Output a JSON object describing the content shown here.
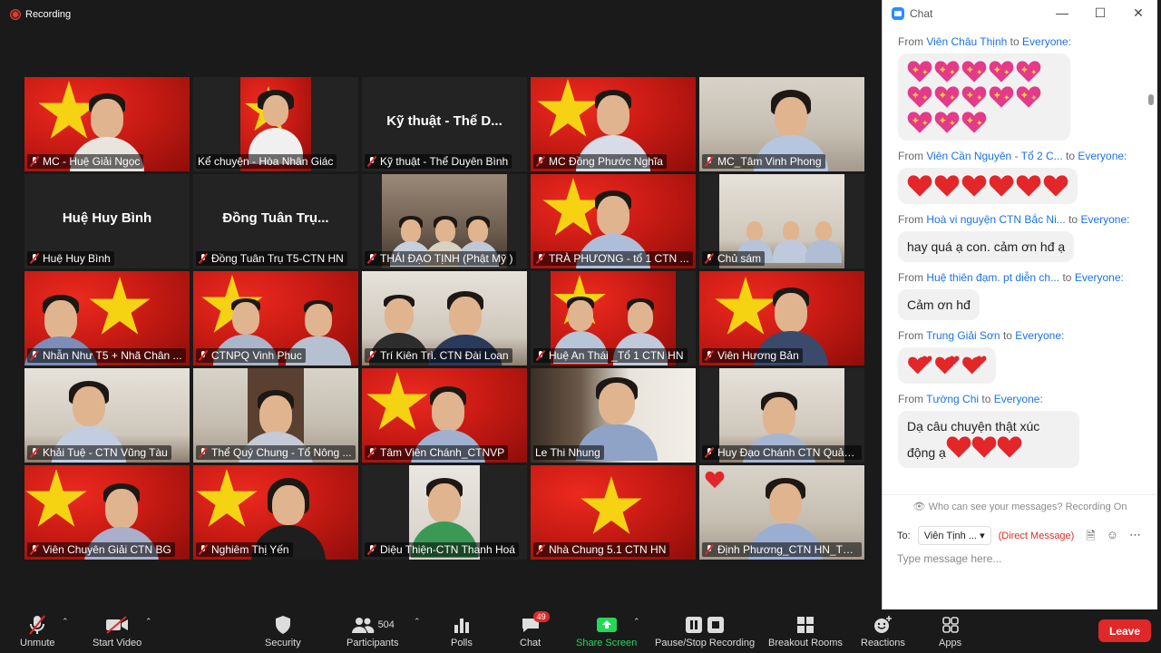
{
  "recording": {
    "label": "Recording"
  },
  "tiles": [
    {
      "name": "MC - Huệ Giải Ngọc"
    },
    {
      "name": "Kể chuyện - Hòa Nhân Giác"
    },
    {
      "name": "Kỹ thuật - Thể Duyên Bình",
      "center": "Kỹ thuật - Thể D..."
    },
    {
      "name": "MC Đồng Phước Nghĩa"
    },
    {
      "name": "MC_Tâm Vinh Phong"
    },
    {
      "name": "Huệ Huy Bình",
      "center": "Huệ Huy Bình"
    },
    {
      "name": "Đồng Tuân Trụ T5-CTN HN",
      "center": "Đồng Tuân Trụ..."
    },
    {
      "name": "THÁI ĐẠO TỊNH (Phật Mỹ )"
    },
    {
      "name": "TRÀ PHƯƠNG - tổ 1 CTN ..."
    },
    {
      "name": "Chủ sám"
    },
    {
      "name": "Nhẫn Như T5 + Nhã Chân ..."
    },
    {
      "name": "CTNPQ Vinh Phuc"
    },
    {
      "name": "Trí Kiên Trì. CTN Đài Loan"
    },
    {
      "name": "Huệ An Thái _Tổ 1 CTN HN"
    },
    {
      "name": "Viên Hương Bản"
    },
    {
      "name": "Khải Tuệ - CTN Vũng Tàu"
    },
    {
      "name": "Thể Quý Chung - Tổ Nông ..."
    },
    {
      "name": "Tâm Viên Chánh_CTNVP"
    },
    {
      "name": "Le Thi Nhung"
    },
    {
      "name": "Huy Đạo Chánh CTN Quản..."
    },
    {
      "name": "Viên Chuyên Giải CTN BG"
    },
    {
      "name": "Nghiêm Thị Yến"
    },
    {
      "name": "Diệu Thiện-CTN Thanh Hoá"
    },
    {
      "name": "Nhà Chung 5.1 CTN HN"
    },
    {
      "name": "Định Phương_CTN HN_Tổ ..."
    }
  ],
  "chat": {
    "title": "Chat",
    "messages": [
      {
        "from_label": "From",
        "sender": "Viên Châu Thịnh",
        "to_label": "to",
        "recipient": "Everyone:",
        "text": "",
        "hearts": 13,
        "heart_type": "sparkle-heart-icon"
      },
      {
        "from_label": "From",
        "sender": "Viên Cần Nguyên - Tổ 2 C...",
        "to_label": "to",
        "recipient": "Everyone:",
        "text": "",
        "hearts": 6,
        "heart_type": "red-heart-icon"
      },
      {
        "from_label": "From",
        "sender": "Hoà vi nguyện CTN Bắc Ni...",
        "to_label": "to",
        "recipient": "Everyone:",
        "text": "hay quá ạ con. cảm ơn hđ ạ",
        "hearts": 0
      },
      {
        "from_label": "From",
        "sender": "Huệ thiên đạm. pt diễn ch...",
        "to_label": "to",
        "recipient": "Everyone:",
        "text": "Cảm ơn hđ",
        "hearts": 0
      },
      {
        "from_label": "From",
        "sender": "Trung Giải Sơn",
        "to_label": "to",
        "recipient": "Everyone:",
        "text": "",
        "hearts": 3,
        "heart_type": "two-hearts-icon"
      },
      {
        "from_label": "From",
        "sender": "Tường Chi",
        "to_label": "to",
        "recipient": "Everyone:",
        "text": "Dạ câu chuyện thật xúc động ạ",
        "hearts": 3,
        "heart_type": "red-heart-icon"
      }
    ],
    "privacy_note": "Who can see your messages? Recording On",
    "to_label": "To:",
    "to_value": "Viên Tịnh ...",
    "direct_message": "(Direct Message)",
    "input_placeholder": "Type message here..."
  },
  "toolbar": {
    "unmute": "Unmute",
    "start_video": "Start Video",
    "security": "Security",
    "participants": "Participants",
    "participant_count": "504",
    "polls": "Polls",
    "chat": "Chat",
    "chat_badge": "49",
    "share_screen": "Share Screen",
    "recording": "Pause/Stop Recording",
    "breakout": "Breakout Rooms",
    "reactions": "Reactions",
    "apps": "Apps",
    "leave": "Leave"
  },
  "colors": {
    "accent": "#2d8cff",
    "leave": "#e02828",
    "share": "#23d959",
    "active_border": "#e6d64b"
  }
}
